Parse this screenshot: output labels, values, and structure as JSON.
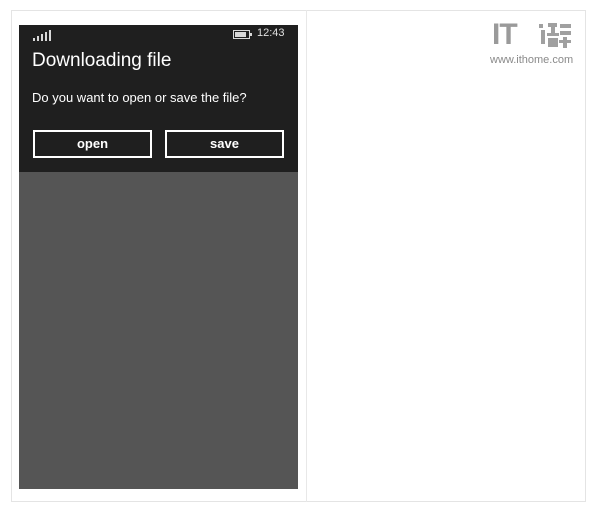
{
  "status_bar": {
    "signal_icon": "signal-strength-icon",
    "battery_icon": "battery-icon",
    "battery_level": 0.85,
    "time": "12:43"
  },
  "dialog": {
    "title": "Downloading file",
    "message": "Do you want to open or save the file?",
    "open_label": "open",
    "save_label": "save"
  },
  "watermark": {
    "logo_text": "IT之家",
    "url": "www.ithome.com"
  },
  "colors": {
    "dialog_background": "#1f1f1f",
    "overlay_background": "#555555",
    "text": "#ffffff",
    "watermark": "#9a9a9a"
  }
}
